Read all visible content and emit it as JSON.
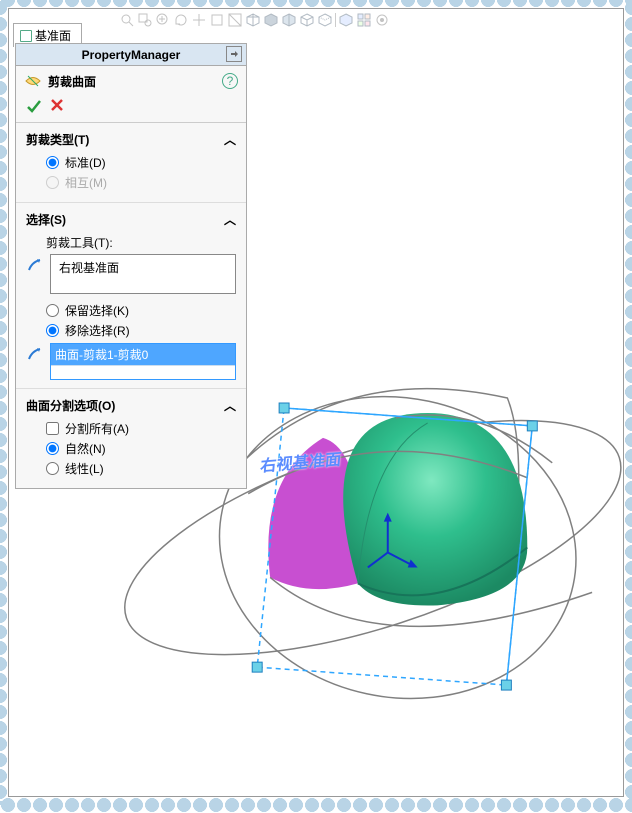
{
  "tab": {
    "label": "基准面"
  },
  "toolbar_icons": [
    "zoom-fit",
    "zoom-area",
    "zoom-in",
    "rotate",
    "pan",
    "view-normal",
    "view-iso",
    "shadow",
    "section",
    "wireframe",
    "shaded",
    "shaded-edges",
    "display-states",
    "scene",
    "view-orientation"
  ],
  "pm": {
    "header": "PropertyManager",
    "feature_title": "剪裁曲面",
    "sections": {
      "trim_type": {
        "title": "剪裁类型(T)",
        "options": {
          "standard": "标准(D)",
          "mutual": "相互(M)"
        },
        "selected": "standard"
      },
      "selection": {
        "title": "选择(S)",
        "tool_label": "剪裁工具(T):",
        "tool_value": "右视基准面",
        "keep_label": "保留选择(K)",
        "remove_label": "移除选择(R)",
        "mode_selected": "remove",
        "target_value": "曲面-剪裁1-剪裁0"
      },
      "split_options": {
        "title": "曲面分割选项(O)",
        "split_all": "分割所有(A)",
        "natural": "自然(N)",
        "linear": "线性(L)",
        "selected": "natural"
      }
    }
  },
  "viewport": {
    "plane_label": "右视基准面"
  },
  "colors": {
    "dome": "#2fbf8d",
    "dome_highlight": "#65e0b5",
    "trim": "#c84fd1",
    "wire": "#808080",
    "select": "#2ea6ff",
    "handle_fill": "#6bd1e8"
  }
}
